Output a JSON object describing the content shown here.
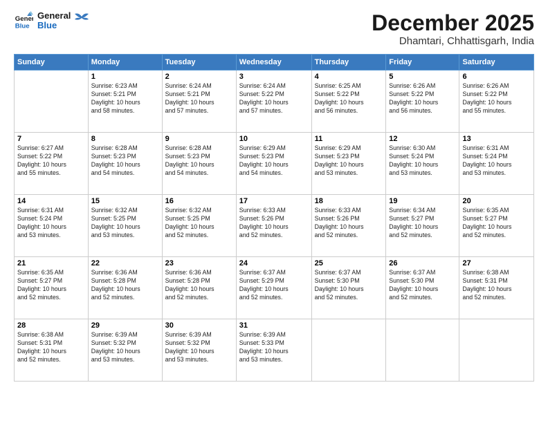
{
  "logo": {
    "line1": "General",
    "line2": "Blue"
  },
  "header": {
    "month": "December 2025",
    "location": "Dhamtari, Chhattisgarh, India"
  },
  "weekdays": [
    "Sunday",
    "Monday",
    "Tuesday",
    "Wednesday",
    "Thursday",
    "Friday",
    "Saturday"
  ],
  "weeks": [
    [
      {
        "day": "",
        "info": ""
      },
      {
        "day": "1",
        "info": "Sunrise: 6:23 AM\nSunset: 5:21 PM\nDaylight: 10 hours\nand 58 minutes."
      },
      {
        "day": "2",
        "info": "Sunrise: 6:24 AM\nSunset: 5:21 PM\nDaylight: 10 hours\nand 57 minutes."
      },
      {
        "day": "3",
        "info": "Sunrise: 6:24 AM\nSunset: 5:22 PM\nDaylight: 10 hours\nand 57 minutes."
      },
      {
        "day": "4",
        "info": "Sunrise: 6:25 AM\nSunset: 5:22 PM\nDaylight: 10 hours\nand 56 minutes."
      },
      {
        "day": "5",
        "info": "Sunrise: 6:26 AM\nSunset: 5:22 PM\nDaylight: 10 hours\nand 56 minutes."
      },
      {
        "day": "6",
        "info": "Sunrise: 6:26 AM\nSunset: 5:22 PM\nDaylight: 10 hours\nand 55 minutes."
      }
    ],
    [
      {
        "day": "7",
        "info": "Sunrise: 6:27 AM\nSunset: 5:22 PM\nDaylight: 10 hours\nand 55 minutes."
      },
      {
        "day": "8",
        "info": "Sunrise: 6:28 AM\nSunset: 5:23 PM\nDaylight: 10 hours\nand 54 minutes."
      },
      {
        "day": "9",
        "info": "Sunrise: 6:28 AM\nSunset: 5:23 PM\nDaylight: 10 hours\nand 54 minutes."
      },
      {
        "day": "10",
        "info": "Sunrise: 6:29 AM\nSunset: 5:23 PM\nDaylight: 10 hours\nand 54 minutes."
      },
      {
        "day": "11",
        "info": "Sunrise: 6:29 AM\nSunset: 5:23 PM\nDaylight: 10 hours\nand 53 minutes."
      },
      {
        "day": "12",
        "info": "Sunrise: 6:30 AM\nSunset: 5:24 PM\nDaylight: 10 hours\nand 53 minutes."
      },
      {
        "day": "13",
        "info": "Sunrise: 6:31 AM\nSunset: 5:24 PM\nDaylight: 10 hours\nand 53 minutes."
      }
    ],
    [
      {
        "day": "14",
        "info": "Sunrise: 6:31 AM\nSunset: 5:24 PM\nDaylight: 10 hours\nand 53 minutes."
      },
      {
        "day": "15",
        "info": "Sunrise: 6:32 AM\nSunset: 5:25 PM\nDaylight: 10 hours\nand 53 minutes."
      },
      {
        "day": "16",
        "info": "Sunrise: 6:32 AM\nSunset: 5:25 PM\nDaylight: 10 hours\nand 52 minutes."
      },
      {
        "day": "17",
        "info": "Sunrise: 6:33 AM\nSunset: 5:26 PM\nDaylight: 10 hours\nand 52 minutes."
      },
      {
        "day": "18",
        "info": "Sunrise: 6:33 AM\nSunset: 5:26 PM\nDaylight: 10 hours\nand 52 minutes."
      },
      {
        "day": "19",
        "info": "Sunrise: 6:34 AM\nSunset: 5:27 PM\nDaylight: 10 hours\nand 52 minutes."
      },
      {
        "day": "20",
        "info": "Sunrise: 6:35 AM\nSunset: 5:27 PM\nDaylight: 10 hours\nand 52 minutes."
      }
    ],
    [
      {
        "day": "21",
        "info": "Sunrise: 6:35 AM\nSunset: 5:27 PM\nDaylight: 10 hours\nand 52 minutes."
      },
      {
        "day": "22",
        "info": "Sunrise: 6:36 AM\nSunset: 5:28 PM\nDaylight: 10 hours\nand 52 minutes."
      },
      {
        "day": "23",
        "info": "Sunrise: 6:36 AM\nSunset: 5:28 PM\nDaylight: 10 hours\nand 52 minutes."
      },
      {
        "day": "24",
        "info": "Sunrise: 6:37 AM\nSunset: 5:29 PM\nDaylight: 10 hours\nand 52 minutes."
      },
      {
        "day": "25",
        "info": "Sunrise: 6:37 AM\nSunset: 5:30 PM\nDaylight: 10 hours\nand 52 minutes."
      },
      {
        "day": "26",
        "info": "Sunrise: 6:37 AM\nSunset: 5:30 PM\nDaylight: 10 hours\nand 52 minutes."
      },
      {
        "day": "27",
        "info": "Sunrise: 6:38 AM\nSunset: 5:31 PM\nDaylight: 10 hours\nand 52 minutes."
      }
    ],
    [
      {
        "day": "28",
        "info": "Sunrise: 6:38 AM\nSunset: 5:31 PM\nDaylight: 10 hours\nand 52 minutes."
      },
      {
        "day": "29",
        "info": "Sunrise: 6:39 AM\nSunset: 5:32 PM\nDaylight: 10 hours\nand 53 minutes."
      },
      {
        "day": "30",
        "info": "Sunrise: 6:39 AM\nSunset: 5:32 PM\nDaylight: 10 hours\nand 53 minutes."
      },
      {
        "day": "31",
        "info": "Sunrise: 6:39 AM\nSunset: 5:33 PM\nDaylight: 10 hours\nand 53 minutes."
      },
      {
        "day": "",
        "info": ""
      },
      {
        "day": "",
        "info": ""
      },
      {
        "day": "",
        "info": ""
      }
    ]
  ]
}
